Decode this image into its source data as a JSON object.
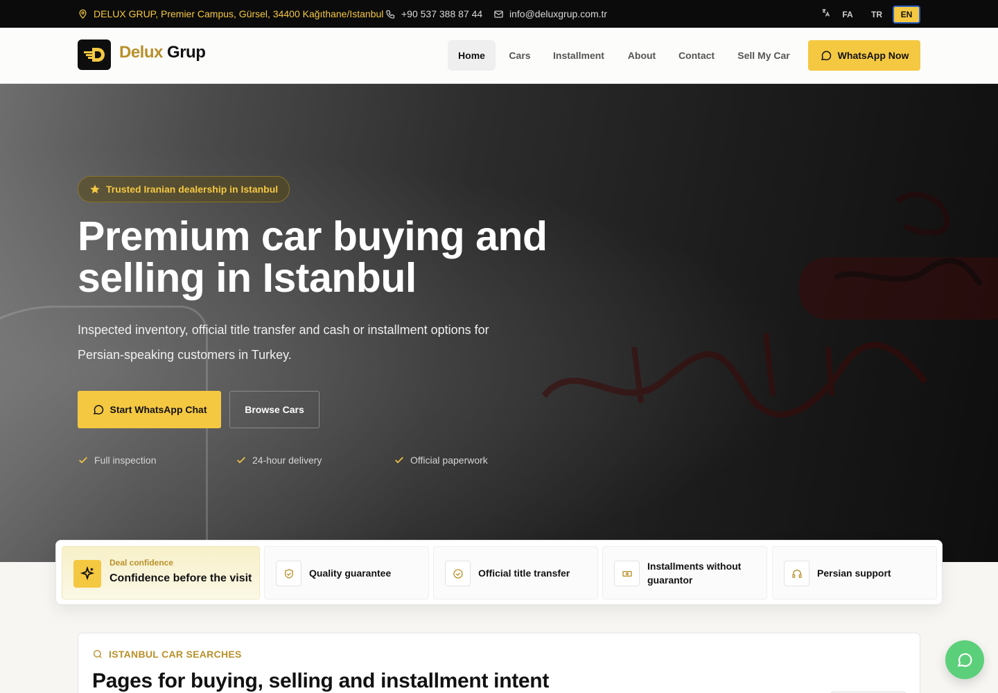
{
  "topbar": {
    "address": "DELUX GRUP, Premier Campus, Gürsel, 34400 Kağıthane/Istanbul",
    "phone": "+90 537 388 87 44",
    "email": "info@deluxgrup.com.tr",
    "languages": [
      "FA",
      "TR",
      "EN"
    ],
    "active_language": "EN"
  },
  "header": {
    "logo_part1": "Delux",
    "logo_part2": "Grup",
    "nav": [
      "Home",
      "Cars",
      "Installment",
      "About",
      "Contact",
      "Sell My Car"
    ],
    "active_nav": "Home",
    "cta": "WhatsApp Now"
  },
  "hero": {
    "badge": "Trusted Iranian dealership in Istanbul",
    "title": "Premium car buying and selling in Istanbul",
    "subtitle": "Inspected inventory, official title transfer and cash or installment options for Persian-speaking customers in Turkey.",
    "primary_cta": "Start WhatsApp Chat",
    "secondary_cta": "Browse Cars",
    "checks": [
      "Full inspection",
      "24-hour delivery",
      "Official paperwork"
    ]
  },
  "features": {
    "highlight_kicker": "Deal confidence",
    "highlight_title": "Confidence before the visit",
    "items": [
      "Quality guarantee",
      "Official title transfer",
      "Installments without guarantor",
      "Persian support"
    ],
    "icons": [
      "sparkle-icon",
      "shield-check-icon",
      "badge-check-icon",
      "banknote-icon",
      "headphones-icon"
    ]
  },
  "section": {
    "kicker": "ISTANBUL CAR SEARCHES",
    "title": "Pages for buying, selling and installment intent"
  },
  "colors": {
    "accent": "#f5c842",
    "brand_gold": "#b8902a",
    "whatsapp": "#5ccf7a",
    "topbar": "#0b0b0b"
  }
}
